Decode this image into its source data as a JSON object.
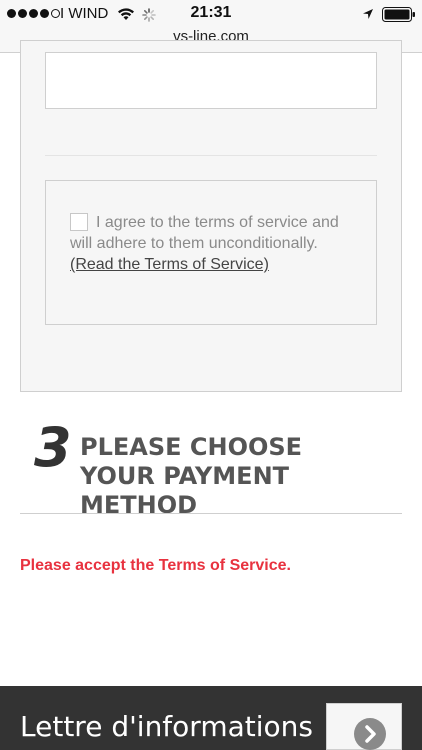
{
  "status_bar": {
    "carrier": "I WIND",
    "time": "21:31"
  },
  "browser": {
    "url": "vs-line.com"
  },
  "form": {
    "terms_text": "I agree to the terms of service and will adhere to them unconditionally.",
    "terms_link": "(Read the Terms of Service)"
  },
  "step3": {
    "number": "3",
    "title": "PLEASE CHOOSE YOUR PAYMENT METHOD"
  },
  "error_message": "Please accept the Terms of Service.",
  "footer": {
    "title": "Lettre d'informations"
  },
  "colors": {
    "error": "#e8323f",
    "footer_bg": "#333333"
  },
  "icons": [
    "wifi-icon",
    "spinner-icon",
    "location-arrow-icon",
    "battery-icon",
    "chevron-right-icon"
  ]
}
